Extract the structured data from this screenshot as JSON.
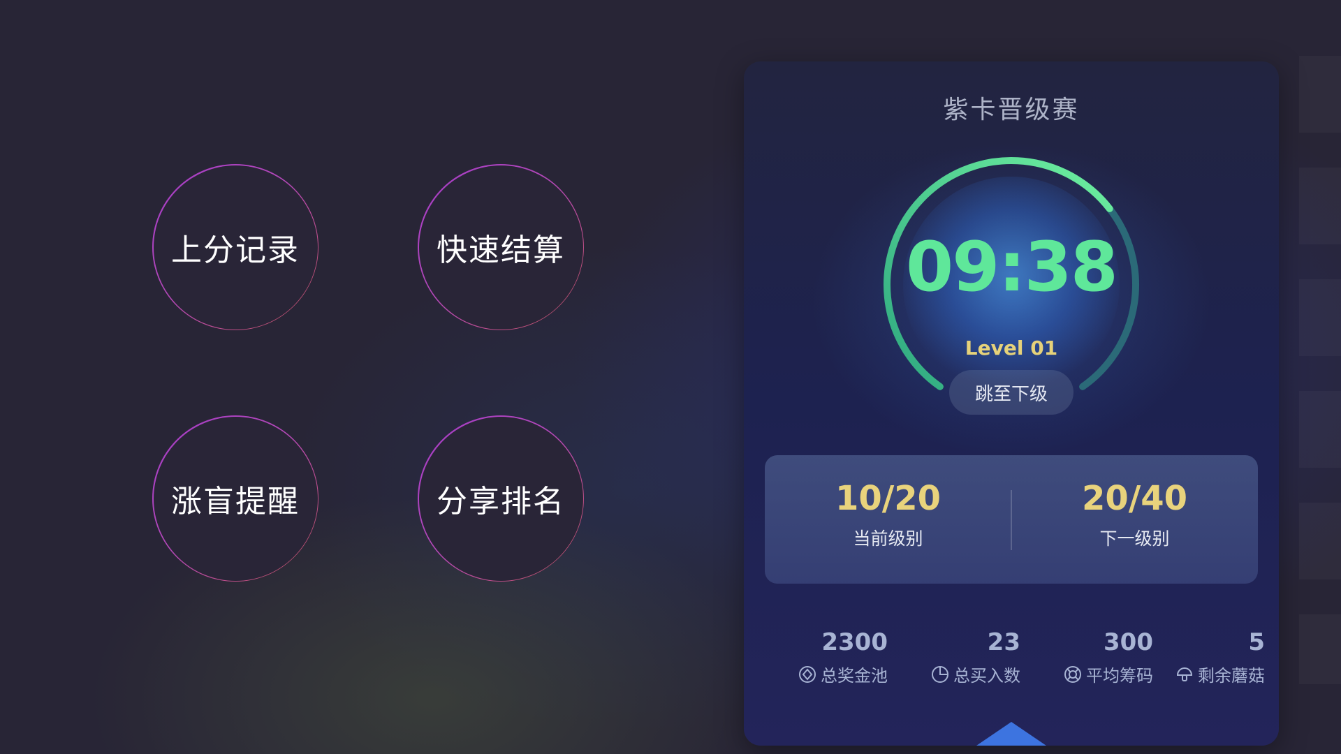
{
  "actions": [
    {
      "label": "上分记录"
    },
    {
      "label": "快速结算"
    },
    {
      "label": "涨盲提醒"
    },
    {
      "label": "分享排名"
    }
  ],
  "panel": {
    "title": "紫卡晋级赛",
    "timer": "09:38",
    "level": "Level 01",
    "jump_label": "跳至下级",
    "progress_fraction": 0.68,
    "current_level": {
      "value": "10/20",
      "label": "当前级别"
    },
    "next_level": {
      "value": "20/40",
      "label": "下一级别"
    },
    "stats": [
      {
        "value": "2300",
        "label": "总奖金池",
        "icon": "prize-pool-icon"
      },
      {
        "value": "23",
        "label": "总买入数",
        "icon": "pie-chart-icon"
      },
      {
        "value": "300",
        "label": "平均筹码",
        "icon": "chip-icon"
      },
      {
        "value": "5",
        "label": "剩余蘑菇",
        "icon": "mushroom-icon"
      }
    ]
  },
  "colors": {
    "accent_green": "#5fe79a",
    "accent_gold": "#e9d37c",
    "ring_purple": "#a53cc9",
    "ring_red": "#c8555f"
  }
}
